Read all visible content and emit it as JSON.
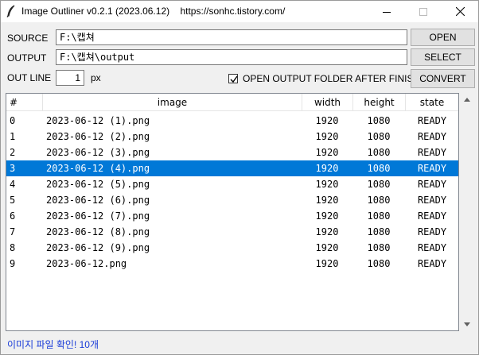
{
  "window": {
    "title": "Image Outliner v0.2.1 (2023.06.12)",
    "url": "https://sonhc.tistory.com/"
  },
  "source": {
    "label": "SOURCE",
    "value": "F:\\캡쳐",
    "button": "OPEN"
  },
  "output": {
    "label": "OUTPUT",
    "value": "F:\\캡쳐\\output",
    "button": "SELECT"
  },
  "outline": {
    "label": "OUT LINE",
    "value": "1",
    "unit": "px"
  },
  "open_folder": {
    "label": "OPEN OUTPUT FOLDER AFTER FINISH",
    "checked": true
  },
  "convert_button": "CONVERT",
  "table": {
    "columns": [
      "#",
      "image",
      "width",
      "height",
      "state"
    ],
    "rows": [
      {
        "num": "0",
        "image": "2023-06-12 (1).png",
        "width": "1920",
        "height": "1080",
        "state": "READY"
      },
      {
        "num": "1",
        "image": "2023-06-12 (2).png",
        "width": "1920",
        "height": "1080",
        "state": "READY"
      },
      {
        "num": "2",
        "image": "2023-06-12 (3).png",
        "width": "1920",
        "height": "1080",
        "state": "READY"
      },
      {
        "num": "3",
        "image": "2023-06-12 (4).png",
        "width": "1920",
        "height": "1080",
        "state": "READY"
      },
      {
        "num": "4",
        "image": "2023-06-12 (5).png",
        "width": "1920",
        "height": "1080",
        "state": "READY"
      },
      {
        "num": "5",
        "image": "2023-06-12 (6).png",
        "width": "1920",
        "height": "1080",
        "state": "READY"
      },
      {
        "num": "6",
        "image": "2023-06-12 (7).png",
        "width": "1920",
        "height": "1080",
        "state": "READY"
      },
      {
        "num": "7",
        "image": "2023-06-12 (8).png",
        "width": "1920",
        "height": "1080",
        "state": "READY"
      },
      {
        "num": "8",
        "image": "2023-06-12 (9).png",
        "width": "1920",
        "height": "1080",
        "state": "READY"
      },
      {
        "num": "9",
        "image": "2023-06-12.png",
        "width": "1920",
        "height": "1080",
        "state": "READY"
      }
    ],
    "selected_row": 3
  },
  "status_text": "이미지 파일 확인!  10개",
  "colors": {
    "selection": "#0078d7",
    "status_text": "#1a3cd8"
  },
  "icons": {
    "app": "feather-icon",
    "minimize": "minimize-icon",
    "maximize": "maximize-icon",
    "close": "close-icon"
  }
}
